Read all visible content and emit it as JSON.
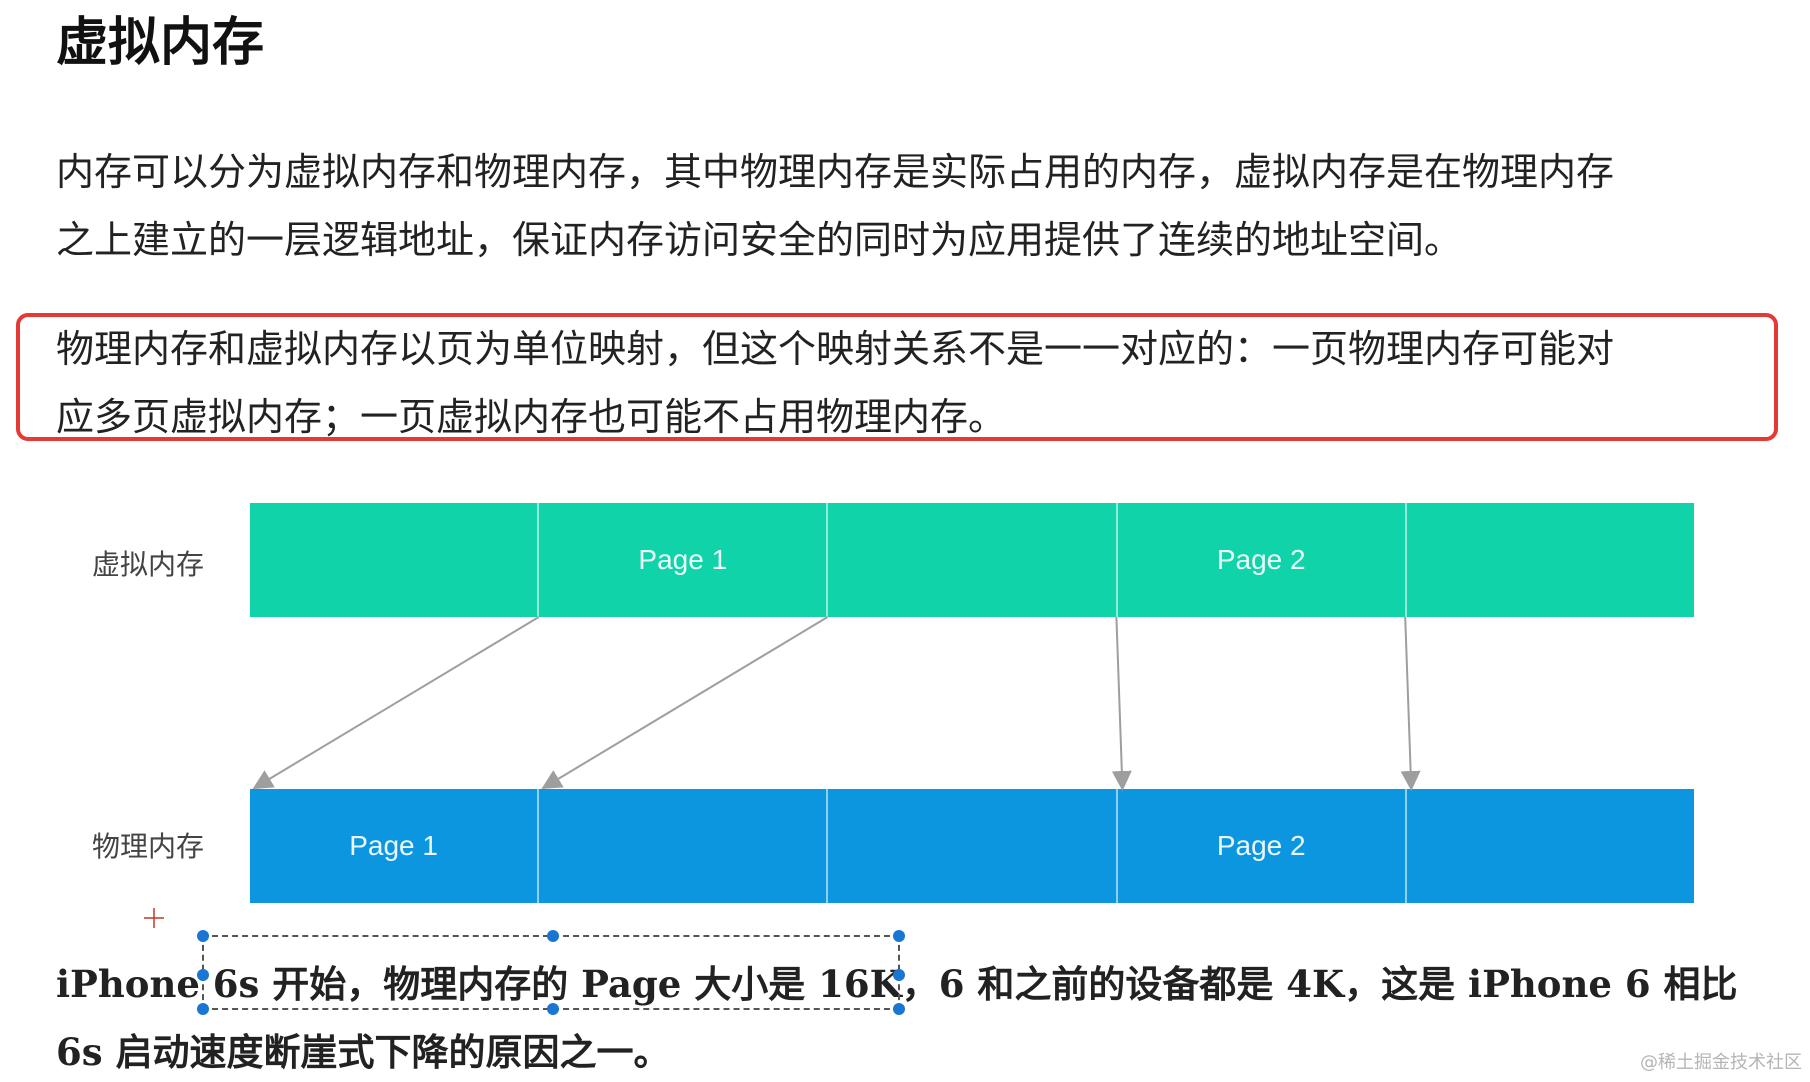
{
  "title": "虚拟内存",
  "paragraph1": {
    "line1": "内存可以分为虚拟内存和物理内存，其中物理内存是实际占用的内存，虚拟内存是在物理内存",
    "line2": "之上建立的一层逻辑地址，保证内存访问安全的同时为应用提供了连续的地址空间。"
  },
  "paragraph2": {
    "line1": "物理内存和虚拟内存以页为单位映射，但这个映射关系不是一一对应的：一页物理内存可能对",
    "line2": "应多页虚拟内存；一页虚拟内存也可能不占用物理内存。"
  },
  "diagram": {
    "virtual_label": "虚拟内存",
    "physical_label": "物理内存",
    "virtual_segments": [
      "",
      "Page 1",
      "",
      "Page 2",
      ""
    ],
    "physical_segments": [
      "Page 1",
      "",
      "",
      "Page 2",
      ""
    ],
    "mappings": [
      {
        "from_virtual_segment": 1,
        "to_physical_segment": 0
      },
      {
        "from_virtual_segment": 2,
        "to_physical_segment": 1
      },
      {
        "from_virtual_segment": 3,
        "to_physical_segment": 3
      },
      {
        "from_virtual_segment": 4,
        "to_physical_segment": 4
      }
    ],
    "colors": {
      "virtual": "#11d3aa",
      "physical": "#0c96df",
      "arrow": "#9e9e9e",
      "highlight_border": "#e53935",
      "selection_handle": "#1976d2"
    }
  },
  "paragraph3": {
    "line1": "iPhone 6s 开始，物理内存的 Page 大小是 16K，6 和之前的设备都是 4K，这是 iPhone 6 相比",
    "line2": "6s 启动速度断崖式下降的原因之一。"
  },
  "watermark": "@稀土掘金技术社区"
}
